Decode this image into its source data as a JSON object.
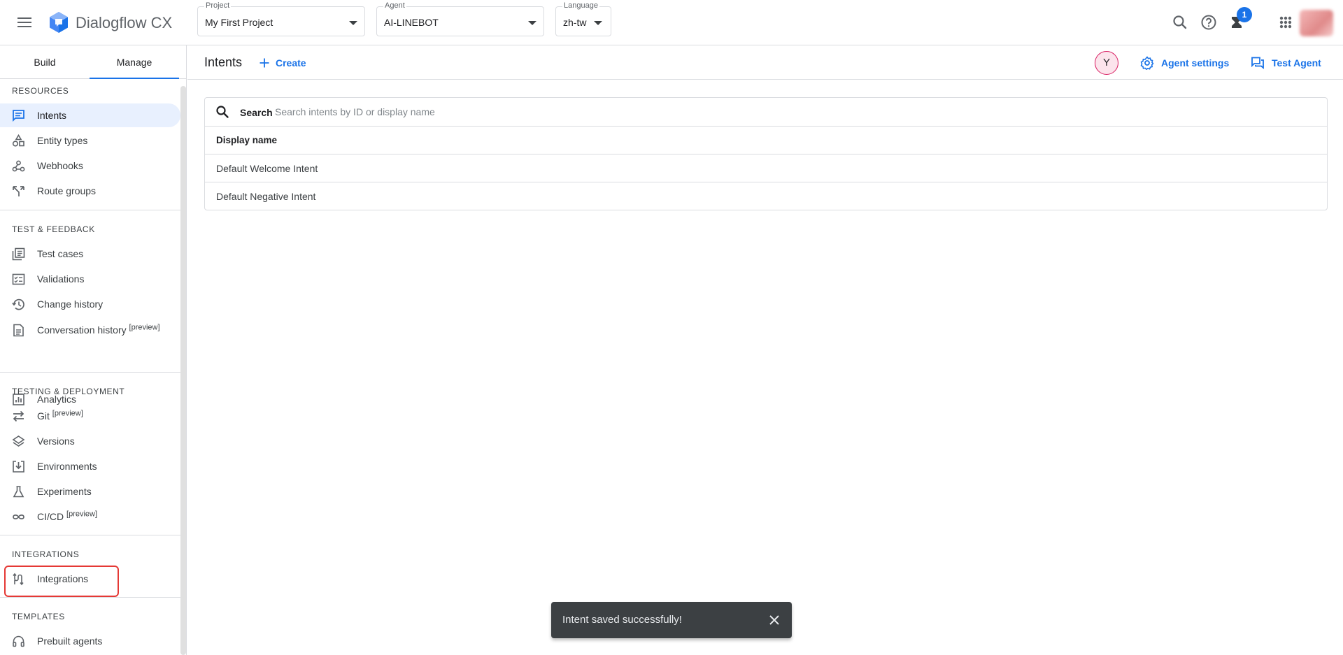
{
  "header": {
    "app_name": "Dialogflow CX",
    "project": {
      "label": "Project",
      "value": "My First Project"
    },
    "agent": {
      "label": "Agent",
      "value": "AI-LINEBOT"
    },
    "language": {
      "label": "Language",
      "value": "zh-tw"
    },
    "notification_count": "1",
    "icons": [
      "menu-icon",
      "dialogflow-logo",
      "search-icon",
      "help-icon",
      "notifications-icon",
      "apps-grid-icon",
      "account-avatar"
    ]
  },
  "sidebar": {
    "tabs": [
      {
        "label": "Build",
        "active": false
      },
      {
        "label": "Manage",
        "active": true
      }
    ],
    "sections": {
      "resources": "RESOURCES",
      "test_feedback": "TEST & FEEDBACK",
      "testing_deployment": "TESTING & DEPLOYMENT",
      "integrations": "INTEGRATIONS",
      "templates": "TEMPLATES"
    },
    "items": {
      "intents": "Intents",
      "entity_types": "Entity types",
      "webhooks": "Webhooks",
      "route_groups": "Route groups",
      "test_cases": "Test cases",
      "validations": "Validations",
      "change_history": "Change history",
      "conversation_history": "Conversation history",
      "analytics": "Analytics",
      "git": "Git",
      "versions": "Versions",
      "environments": "Environments",
      "experiments": "Experiments",
      "cicd": "CI/CD",
      "integrations": "Integrations",
      "prebuilt_agents": "Prebuilt agents"
    },
    "preview_tag": "[preview]",
    "active_item": "Intents",
    "highlighted_item": "Integrations"
  },
  "main": {
    "title": "Intents",
    "create_label": "Create",
    "user_initial": "Y",
    "agent_settings_label": "Agent settings",
    "test_agent_label": "Test Agent",
    "search": {
      "label": "Search",
      "placeholder": "Search intents by ID or display name"
    },
    "table": {
      "column": "Display name",
      "rows": [
        "Default Welcome Intent",
        "Default Negative Intent"
      ]
    }
  },
  "snackbar": {
    "message": "Intent saved successfully!"
  },
  "colors": {
    "accent": "#1a73e8",
    "active_nav_bg": "#e8f0fe",
    "highlight_box": "#e53935",
    "snackbar_bg": "#3c4043",
    "avatar_border": "#d81b60"
  }
}
